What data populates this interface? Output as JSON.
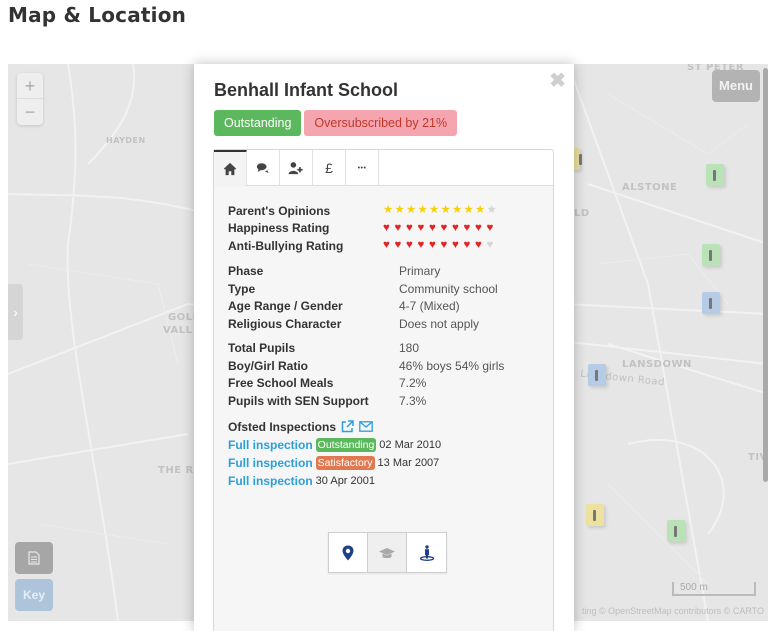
{
  "page": {
    "title": "Map & Location"
  },
  "map": {
    "zoom_in_label": "+",
    "zoom_out_label": "−",
    "side_toggle_icon": "chevron-right-icon",
    "side_toggle_glyph": "›",
    "menu_label": "Menu",
    "key_label": "Key",
    "document_icon": "document-icon",
    "scale_label": "500 m",
    "attribution": "ting © OpenStreetMap contributors © CARTO",
    "place_labels": [
      "HAYDEN",
      "GOLD",
      "VALL",
      "THE R",
      "ALSTONE",
      "LD",
      "LANSDOWN",
      "ST PETER",
      "TIV"
    ],
    "road_labels": [
      "Lansdown Road"
    ],
    "markers": [
      {
        "color": "green"
      },
      {
        "color": "green"
      },
      {
        "color": "blue"
      },
      {
        "color": "blue"
      },
      {
        "color": "yellow"
      },
      {
        "color": "green"
      },
      {
        "color": "yellow"
      }
    ]
  },
  "popup": {
    "close_glyph": "✖",
    "school_name": "Benhall Infant School",
    "badges": {
      "rating": "Outstanding",
      "subscription": "Oversubscribed by 21%"
    },
    "tabs": [
      {
        "icon": "home-icon",
        "active": true
      },
      {
        "icon": "comments-icon",
        "active": false
      },
      {
        "icon": "user-plus-icon",
        "active": false
      },
      {
        "icon": "pound-icon",
        "glyph": "£",
        "active": false
      },
      {
        "icon": "more-icon",
        "glyph": "•••",
        "active": false
      }
    ],
    "ratings": [
      {
        "label": "Parent's Opinions",
        "type": "star",
        "value": 9,
        "max": 10
      },
      {
        "label": "Happiness Rating",
        "type": "heart",
        "value": 10,
        "max": 10
      },
      {
        "label": "Anti-Bullying Rating",
        "type": "heart",
        "value": 9,
        "max": 10
      }
    ],
    "details": [
      {
        "label": "Phase",
        "value": "Primary"
      },
      {
        "label": "Type",
        "value": "Community school"
      },
      {
        "label": "Age Range / Gender",
        "value": "4-7 (Mixed)"
      },
      {
        "label": "Religious Character",
        "value": "Does not apply"
      }
    ],
    "stats": [
      {
        "label": "Total Pupils",
        "value": "180"
      },
      {
        "label": "Boy/Girl Ratio",
        "value": "46% boys 54% girls"
      },
      {
        "label": "Free School Meals",
        "value": "7.2%"
      },
      {
        "label": "Pupils with SEN Support",
        "value": "7.3%"
      }
    ],
    "ofsted": {
      "heading": "Ofsted Inspections",
      "inspections": [
        {
          "link": "Full inspection",
          "grade": "Outstanding",
          "grade_color": "green",
          "date": "02 Mar 2010"
        },
        {
          "link": "Full inspection",
          "grade": "Satisfactory",
          "grade_color": "orange",
          "date": "13 Mar 2007"
        },
        {
          "link": "Full inspection",
          "grade": "",
          "grade_color": "",
          "date": "30 Apr 2001"
        }
      ]
    },
    "action_buttons": [
      {
        "icon": "map-marker-icon",
        "selected": false
      },
      {
        "icon": "graduation-cap-icon",
        "selected": true
      },
      {
        "icon": "street-view-icon",
        "selected": false
      }
    ]
  },
  "colors": {
    "accent_link": "#2b9fd9",
    "badge_green": "#5cb85c",
    "badge_pink": "#f5a5af",
    "badge_orange": "#e0794f",
    "icon_navy": "#1f3f8a"
  }
}
